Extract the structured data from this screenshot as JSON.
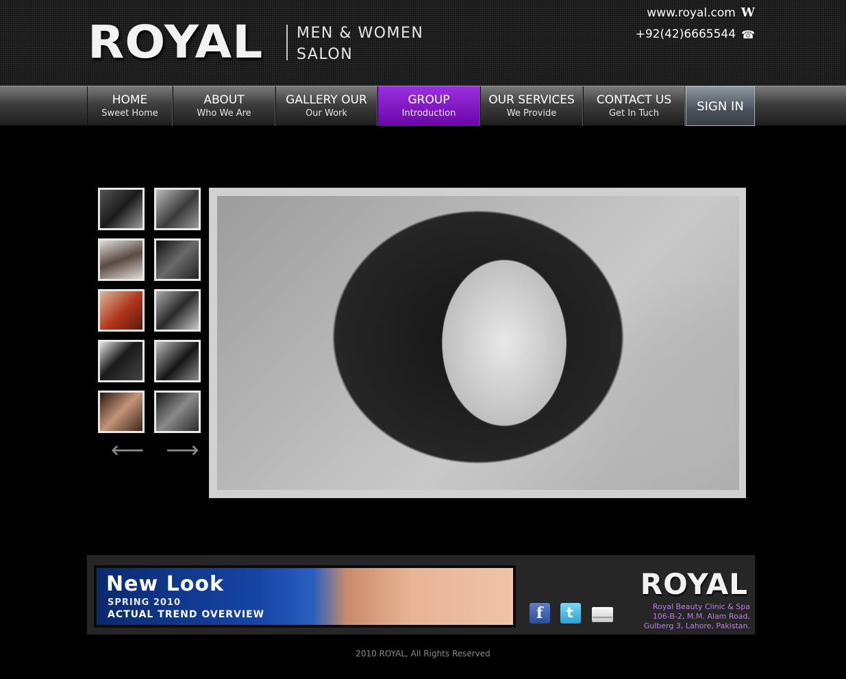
{
  "header": {
    "logo": "ROYAL",
    "tagline_line1": "MEN & WOMEN",
    "tagline_line2": "SALON",
    "website": "www.royal.com",
    "website_icon": "W",
    "phone": "+92(42)6665544",
    "phone_icon": "☎"
  },
  "nav": {
    "items": [
      {
        "title": "HOME",
        "subtitle": "Sweet Home"
      },
      {
        "title": "ABOUT",
        "subtitle": "Who We Are"
      },
      {
        "title": "GALLERY OUR",
        "subtitle": "Our Work"
      },
      {
        "title": "GROUP",
        "subtitle": "Introduction"
      },
      {
        "title": "OUR SERVICES",
        "subtitle": "We Provide"
      },
      {
        "title": "CONTACT US",
        "subtitle": "Get In Tuch"
      }
    ],
    "active_index": 3,
    "sign_in": "SIGN IN",
    "active_color": "#8a1fd0"
  },
  "gallery": {
    "thumb_count": 10,
    "prev_icon": "⟵",
    "next_icon": "⟶"
  },
  "footer": {
    "banner_title": "New Look",
    "banner_line1": "SPRING 2010",
    "banner_line2": "ACTUAL TREND OVERVIEW",
    "logo": "ROYAL",
    "address_line1": "Royal Beauty Clinic & Spa",
    "address_line2": "106-B-2, M.M. Alam Road,",
    "address_line3": "Gulberg 3, Lahore, Pakistan.",
    "social": [
      "facebook-icon",
      "twitter-icon",
      "mail-icon"
    ],
    "accent_color": "#c07ce8"
  },
  "copyright": "2010 ROYAL, All Rights Reserved"
}
